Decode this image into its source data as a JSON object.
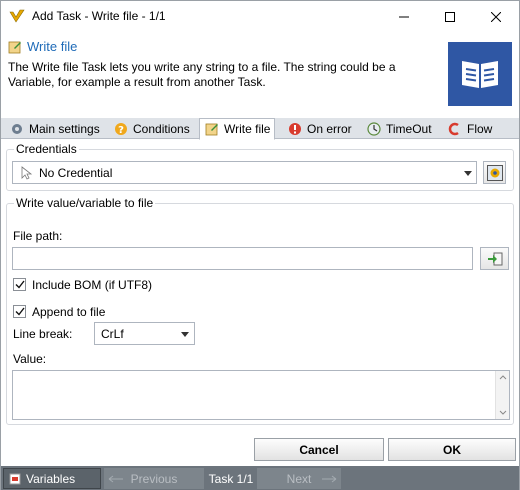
{
  "window": {
    "title": "Add Task - Write file - 1/1"
  },
  "header": {
    "title": "Write file",
    "description": "The Write file Task lets you write any string to a file. The string could be a Variable, for example a result from another Task."
  },
  "tabs": [
    {
      "label": "Main settings",
      "icon": "gear-icon"
    },
    {
      "label": "Conditions",
      "icon": "question-icon"
    },
    {
      "label": "Write file",
      "icon": "write-file-icon"
    },
    {
      "label": "On error",
      "icon": "error-icon"
    },
    {
      "label": "TimeOut",
      "icon": "timeout-icon"
    },
    {
      "label": "Flow",
      "icon": "flow-icon"
    }
  ],
  "credentials": {
    "legend": "Credentials",
    "selected": "No Credential"
  },
  "write_group": {
    "legend": "Write value/variable to file",
    "file_path_label": "File path:",
    "file_path_value": "",
    "include_bom_label": "Include BOM (if UTF8)",
    "include_bom_checked": true,
    "append_label": "Append to file",
    "append_checked": true,
    "line_break_label": "Line break:",
    "line_break_value": "CrLf",
    "value_label": "Value:",
    "value_text": ""
  },
  "buttons": {
    "cancel": "Cancel",
    "ok": "OK"
  },
  "statusbar": {
    "variables": "Variables",
    "previous": "Previous",
    "task_counter": "Task 1/1",
    "next": "Next"
  },
  "colors": {
    "accent": "#1f6bb8",
    "badge": "#2f57a4",
    "statusbar": "#6c747c"
  }
}
